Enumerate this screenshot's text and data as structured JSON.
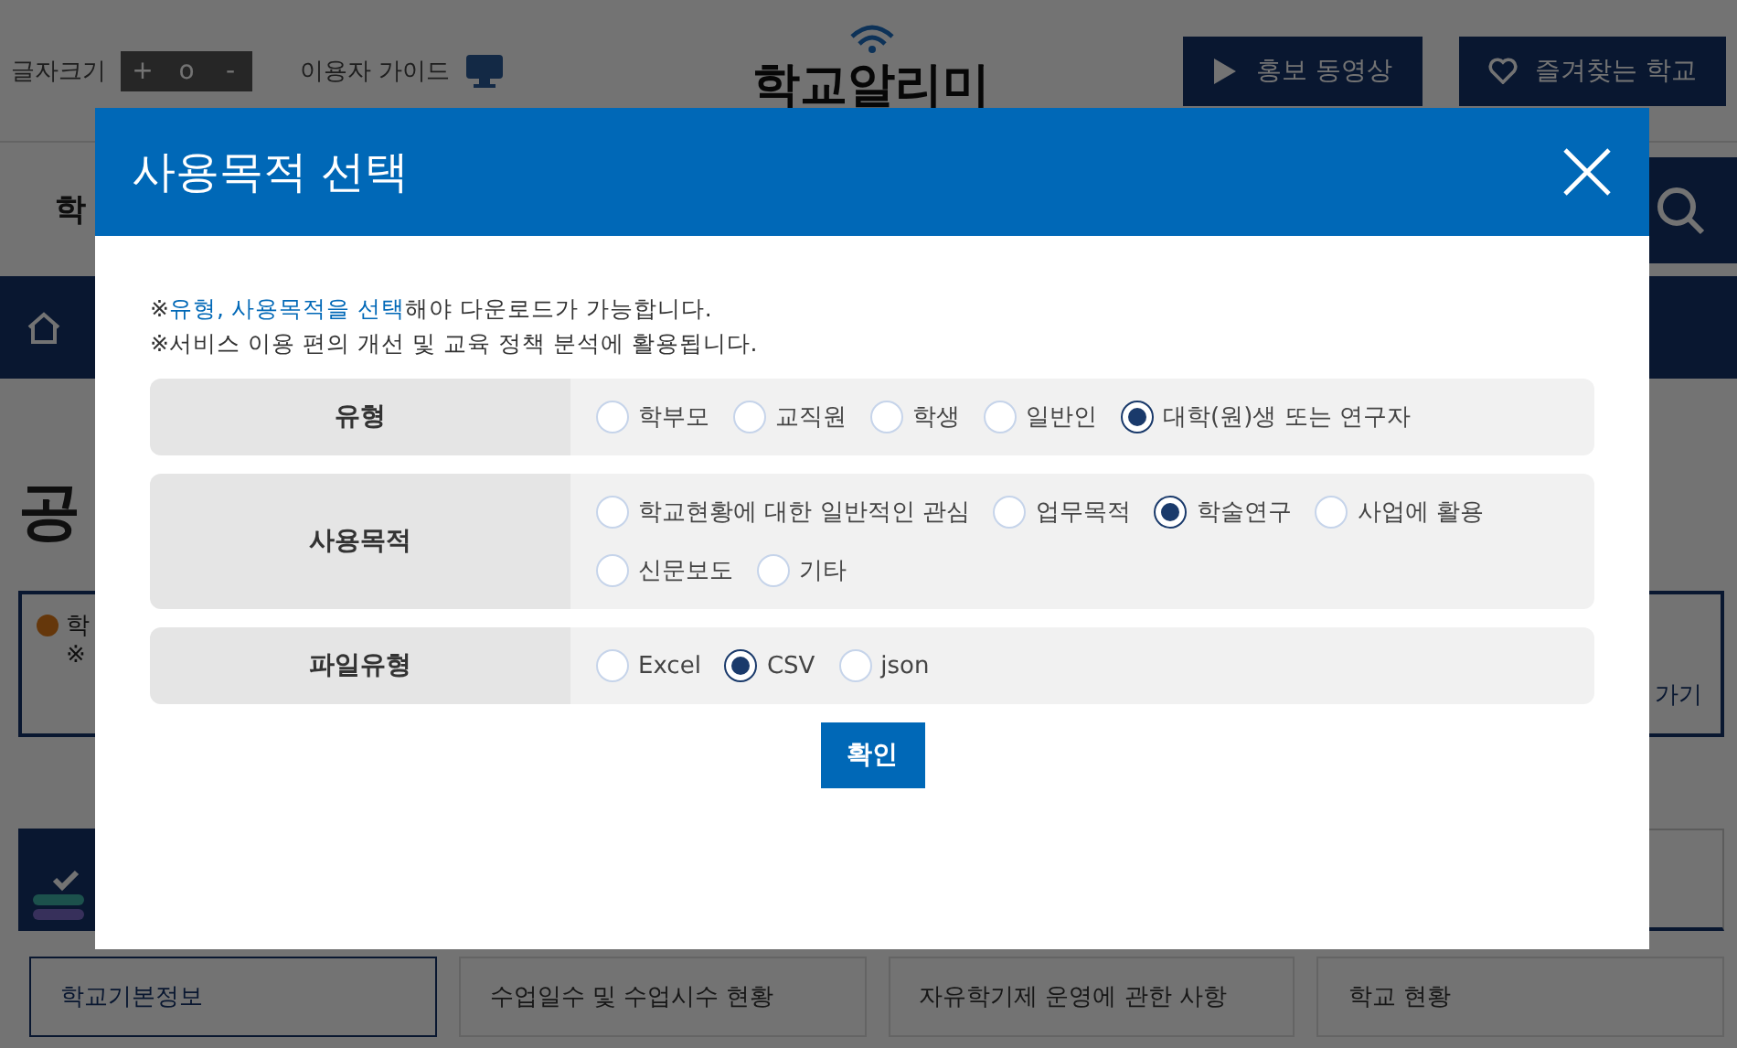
{
  "top_bar": {
    "font_size_label": "글자크기",
    "font_size_buttons": [
      {
        "label": "+"
      },
      {
        "label": "o"
      },
      {
        "label": "-"
      }
    ],
    "guide_label": "이용자 가이드",
    "logo": "학교알리미",
    "buttons": [
      {
        "kind": "play",
        "label": "홍보 동영상"
      },
      {
        "kind": "heart",
        "label": "즐겨찾는 학교"
      }
    ]
  },
  "search": {
    "label": "학"
  },
  "page": {
    "title": "공",
    "notice_lines": [
      "학",
      "※"
    ],
    "notice_link": "가기"
  },
  "tabs": [
    {
      "label": "학교기본정보",
      "selected": true
    },
    {
      "label": "수업일수 및 수업시수 현황",
      "selected": false
    },
    {
      "label": "자유학기제 운영에 관한 사항",
      "selected": false
    },
    {
      "label": "학교 현황",
      "selected": false
    }
  ],
  "dialog": {
    "title": "사용목적 선택",
    "notes": [
      "※**유형, 사용목적을 선택**해야 다운로드가 가능합니다.",
      "※서비스 이용 편의 개선 및 교육 정책 분석에 활용됩니다."
    ],
    "rows": [
      {
        "label": "유형",
        "options": [
          {
            "label": "학부모",
            "selected": false
          },
          {
            "label": "교직원",
            "selected": false
          },
          {
            "label": "학생",
            "selected": false
          },
          {
            "label": "일반인",
            "selected": false
          },
          {
            "label": "대학(원)생 또는 연구자",
            "selected": true
          }
        ]
      },
      {
        "label": "사용목적",
        "options": [
          {
            "label": "학교현황에 대한 일반적인 관심",
            "selected": false
          },
          {
            "label": "업무목적",
            "selected": false
          },
          {
            "label": "학술연구",
            "selected": true
          },
          {
            "label": "사업에 활용",
            "selected": false
          },
          {
            "label": "신문보도",
            "selected": false
          },
          {
            "label": "기타",
            "selected": false
          }
        ]
      },
      {
        "label": "파일유형",
        "options": [
          {
            "label": "Excel",
            "selected": false
          },
          {
            "label": "CSV",
            "selected": true
          },
          {
            "label": "json",
            "selected": false
          }
        ]
      }
    ],
    "confirm": "확인"
  }
}
